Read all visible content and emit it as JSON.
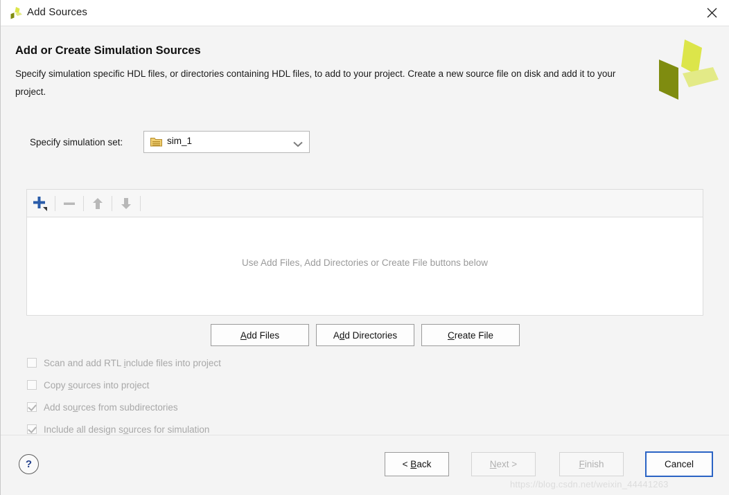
{
  "window": {
    "title": "Add Sources",
    "app_icon": "xilinx-logo-icon",
    "close_icon": "close-icon"
  },
  "header": {
    "title": "Add or Create Simulation Sources",
    "description": "Specify simulation specific HDL files, or directories containing HDL files, to add to your project. Create a new source file on disk and add it to your project.",
    "logo": "xilinx-logo"
  },
  "simulation_set": {
    "label": "Specify simulation set:",
    "value": "sim_1",
    "folder_icon": "folder-icon",
    "chevron_icon": "chevron-down-icon",
    "options": [
      "sim_1"
    ]
  },
  "source_list": {
    "toolbar": [
      {
        "name": "add-source-button",
        "icon": "plus-icon",
        "enabled": true
      },
      {
        "name": "remove-source-button",
        "icon": "minus-icon",
        "enabled": false
      },
      {
        "name": "move-up-button",
        "icon": "arrow-up-icon",
        "enabled": false
      },
      {
        "name": "move-down-button",
        "icon": "arrow-down-icon",
        "enabled": false
      }
    ],
    "empty_text": "Use Add Files, Add Directories or Create File buttons below"
  },
  "actions": {
    "add_files": {
      "prefix": "",
      "mnemonic": "A",
      "suffix": "dd Files"
    },
    "add_directories": {
      "prefix": "A",
      "mnemonic": "d",
      "suffix": "d Directories"
    },
    "create_file": {
      "prefix": "",
      "mnemonic": "C",
      "suffix": "reate File"
    }
  },
  "options": [
    {
      "id": "cb-scan",
      "prefix": "Scan and add RTL ",
      "mnemonic": "i",
      "suffix": "nclude files into project",
      "checked": false,
      "enabled": false
    },
    {
      "id": "cb-copy",
      "prefix": "Copy ",
      "mnemonic": "s",
      "suffix": "ources into project",
      "checked": false,
      "enabled": false
    },
    {
      "id": "cb-subdir",
      "prefix": "Add so",
      "mnemonic": "u",
      "suffix": "rces from subdirectories",
      "checked": true,
      "enabled": false
    },
    {
      "id": "cb-design",
      "prefix": "Include all design s",
      "mnemonic": "o",
      "suffix": "urces for simulation",
      "checked": true,
      "enabled": false
    }
  ],
  "footer": {
    "help_label": "?",
    "back": {
      "prefix": "< ",
      "mnemonic": "B",
      "suffix": "ack",
      "enabled": true,
      "focused": false
    },
    "next": {
      "prefix": "",
      "mnemonic": "N",
      "suffix": "ext >",
      "enabled": false,
      "focused": false
    },
    "finish": {
      "prefix": "",
      "mnemonic": "F",
      "suffix": "inish",
      "enabled": false,
      "focused": false
    },
    "cancel": {
      "prefix": "",
      "mnemonic": "",
      "suffix": "Cancel",
      "enabled": true,
      "focused": true
    }
  },
  "watermark": "https://blog.csdn.net/weixin_44441263",
  "colors": {
    "accent_blue": "#2a5caa",
    "focus_blue": "#2a63c4",
    "logo_light": "#dce54a",
    "logo_mid": "#e3ea87",
    "logo_dark": "#7f8c10",
    "disabled_gray": "#a8a8a8"
  }
}
